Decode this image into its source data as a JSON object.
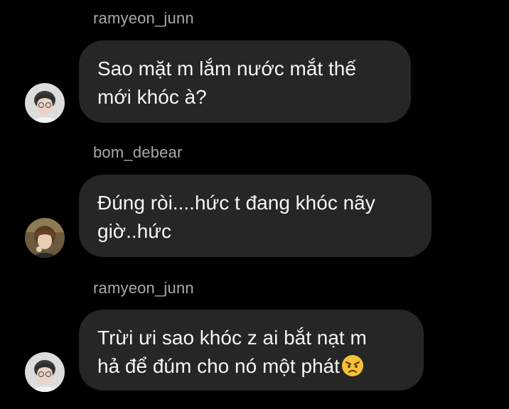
{
  "messages": [
    {
      "username": "ramyeon_junn",
      "lines": [
        "Sao mặt m lắm nước mắt thế",
        "mới khóc à?"
      ]
    },
    {
      "username": "bom_debear",
      "lines": [
        "Đúng ròi....hức t đang khóc nãy",
        "giờ..hức"
      ]
    },
    {
      "username": "ramyeon_junn",
      "lines": [
        "Trừi ưi sao khóc z ai bắt nạt m",
        "hả để đúm cho nó một phát"
      ],
      "emoji": "angry-face-icon"
    }
  ],
  "colors": {
    "background": "#000000",
    "bubble": "#262626",
    "username": "#a8a8a8",
    "text": "#f5f5f5"
  }
}
